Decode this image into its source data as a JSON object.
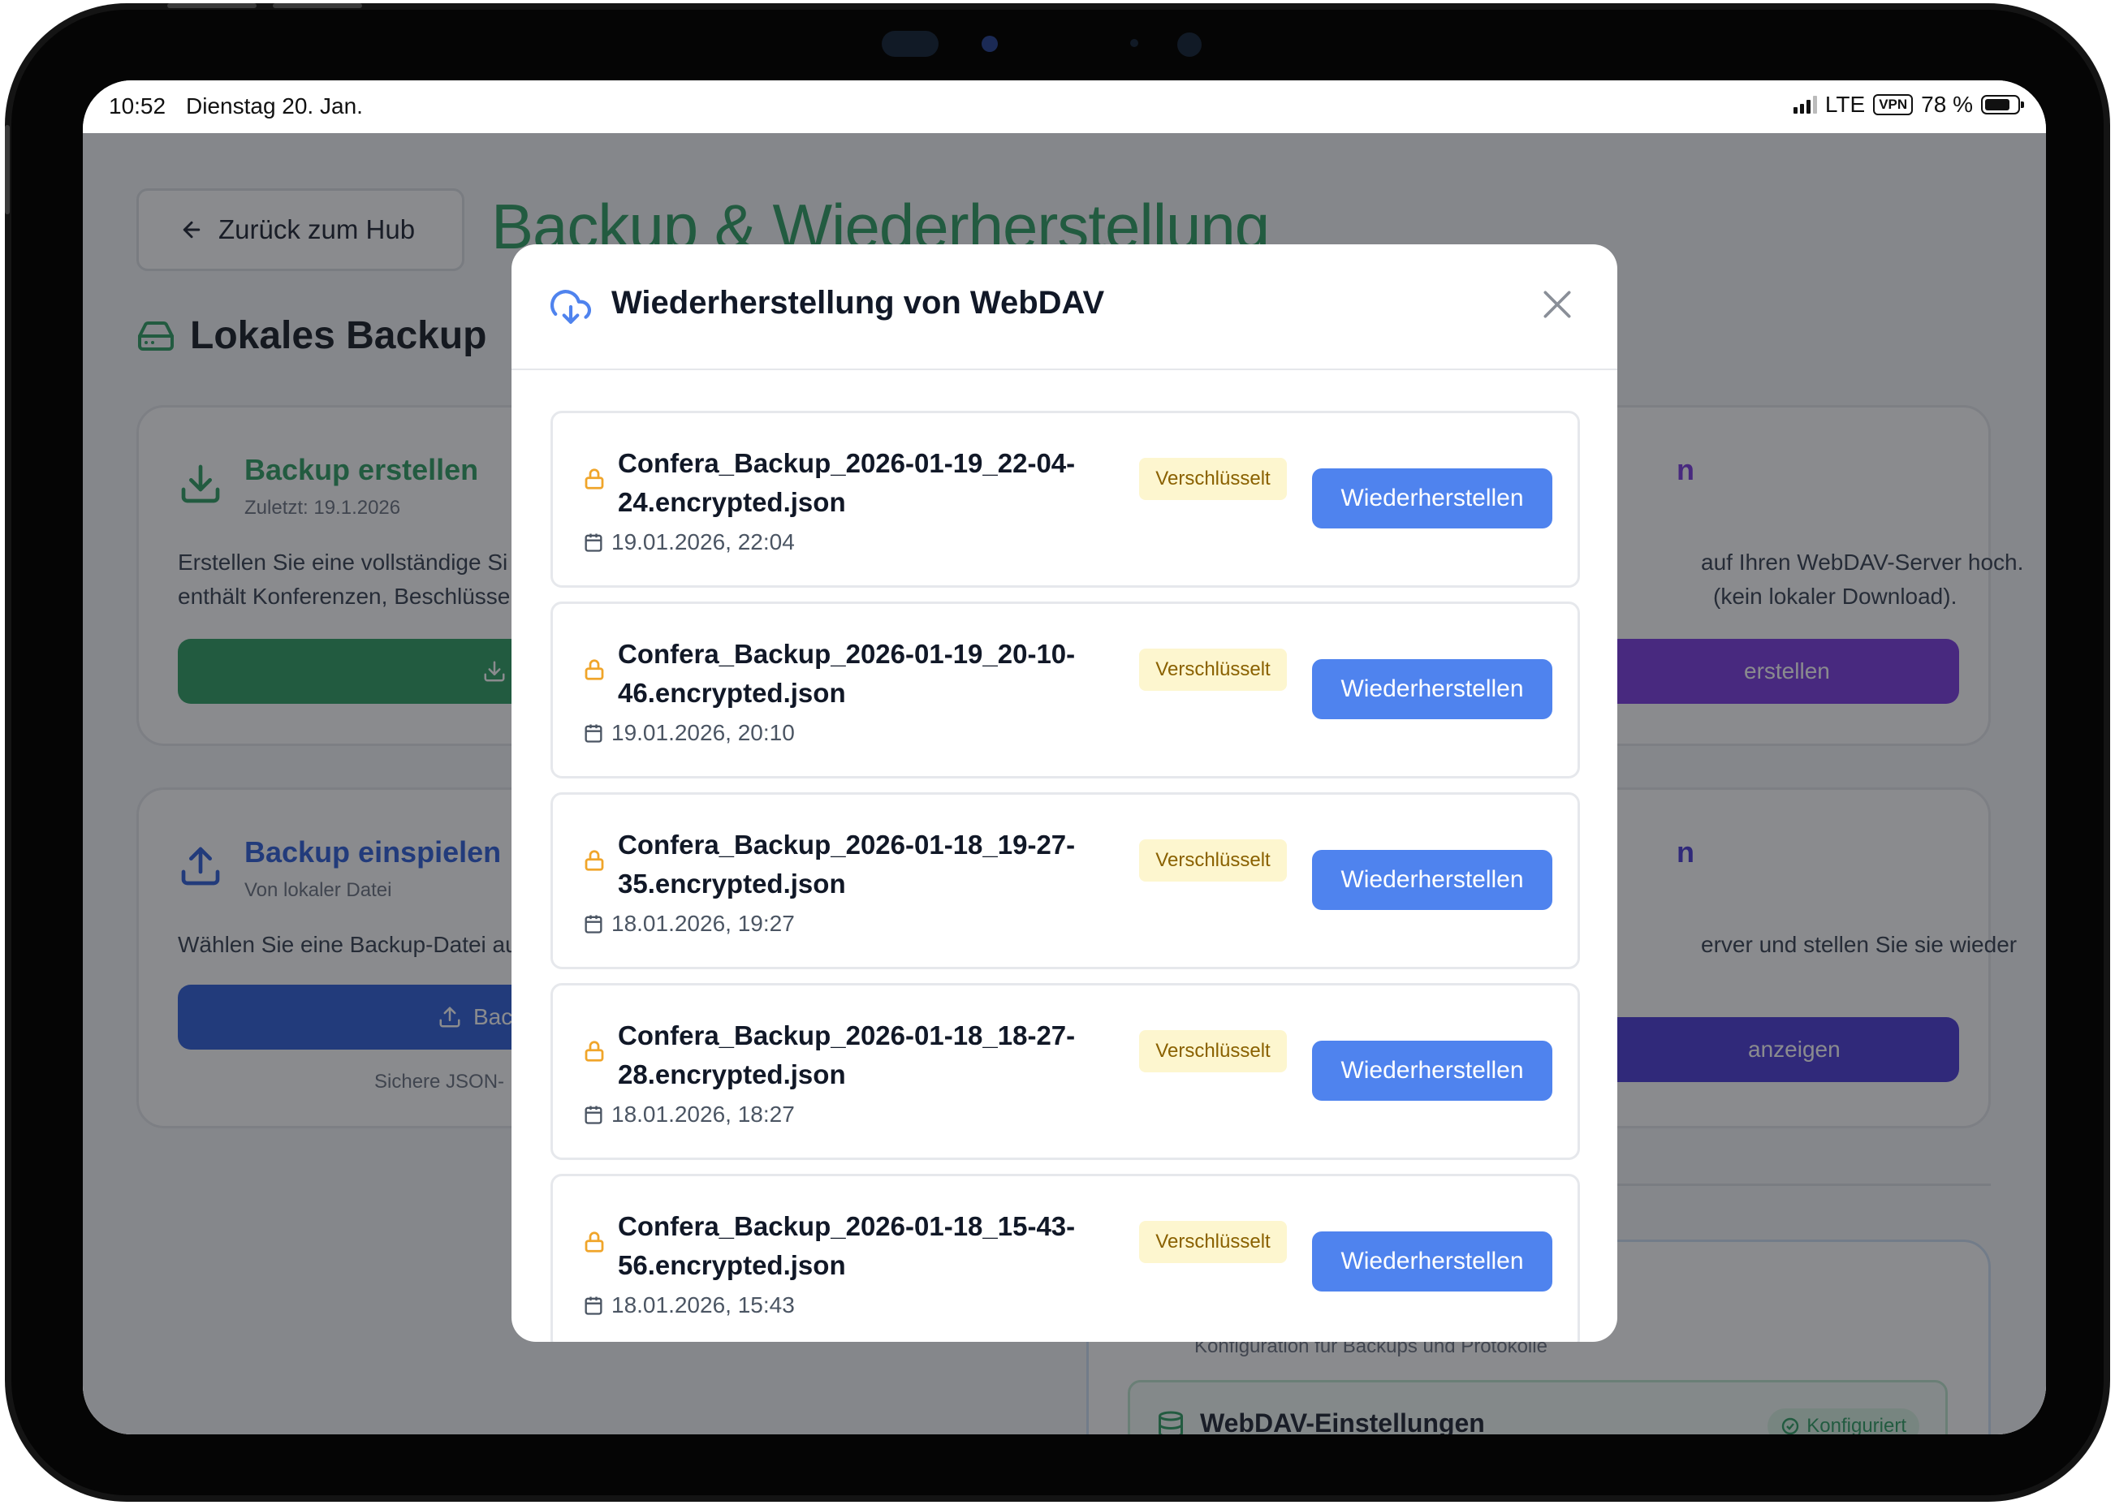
{
  "statusbar": {
    "time": "10:52",
    "date": "Dienstag 20. Jan.",
    "network": "LTE",
    "vpn": "VPN",
    "battery": "78 %",
    "battery_level": 0.78
  },
  "app": {
    "back_label": "Zurück zum Hub",
    "title": "Backup & Wiederherstellung",
    "section_local": "Lokales Backup",
    "cards": {
      "create": {
        "title": "Backup erstellen",
        "subtitle": "Zuletzt: 19.1.2026",
        "text1": "Erstellen Sie eine vollständige Si",
        "text2": "enthält Konferenzen, Beschlüsse"
      },
      "import": {
        "title": "Backup einspielen",
        "subtitle": "Von lokaler Datei",
        "text1": "Wählen Sie eine Backup-Datei au",
        "button": "Bac",
        "note": "Sichere JSON-"
      },
      "webdav_create": {
        "title_fragment": "n",
        "text1": "auf Ihren WebDAV-Server hoch.",
        "text2": "(kein lokaler Download).",
        "button": "erstellen"
      },
      "webdav_restore": {
        "title_fragment": "n",
        "text1": "erver und stellen Sie sie wieder",
        "button": "anzeigen"
      },
      "settings": {
        "subtitle": "Konfiguration für Backups und Protokolle",
        "title": "WebDAV-Einstellungen",
        "badge": "Konfiguriert"
      }
    },
    "colors": {
      "green": "#2f9e63",
      "blue": "#2f5fd8",
      "purple": "#7a3ae0",
      "indigo": "#4b3ad6"
    }
  },
  "modal": {
    "title": "Wiederherstellung von WebDAV",
    "title_icon": "cloud-download-icon",
    "close_icon": "close-icon",
    "badge_label": "Verschlüsselt",
    "restore_label": "Wiederherstellen",
    "accent": "#4f83ee",
    "items": [
      {
        "filename": "Confera_Backup_2026-01-19_22-04-24.encrypted.json",
        "date": "19.01.2026, 22:04"
      },
      {
        "filename": "Confera_Backup_2026-01-19_20-10-46.encrypted.json",
        "date": "19.01.2026, 20:10"
      },
      {
        "filename": "Confera_Backup_2026-01-18_19-27-35.encrypted.json",
        "date": "18.01.2026, 19:27"
      },
      {
        "filename": "Confera_Backup_2026-01-18_18-27-28.encrypted.json",
        "date": "18.01.2026, 18:27"
      },
      {
        "filename": "Confera_Backup_2026-01-18_15-43-56.encrypted.json",
        "date": "18.01.2026, 15:43"
      }
    ]
  }
}
